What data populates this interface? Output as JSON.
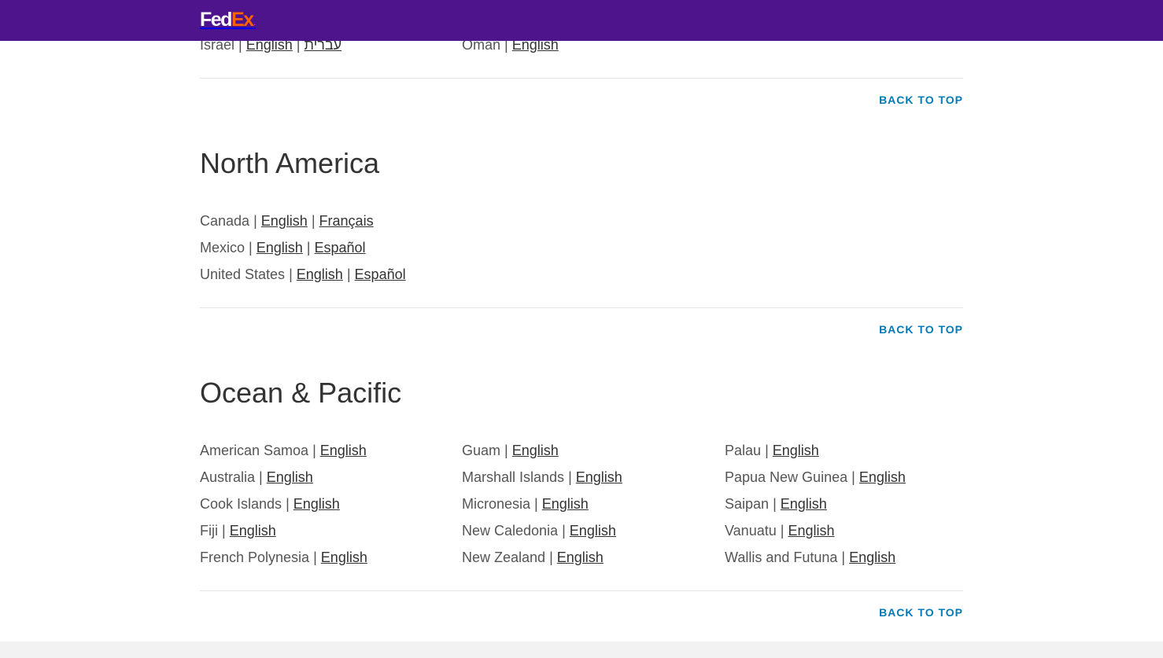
{
  "header": {
    "logo_fed": "Fed",
    "logo_ex": "Ex",
    "logo_dot": "."
  },
  "back_to_top": "BACK TO TOP",
  "separator": "|",
  "middle_east": {
    "columns": [
      [
        {
          "country": "Israel",
          "languages": [
            "English",
            "עברית"
          ]
        }
      ],
      [
        {
          "country": "Oman",
          "languages": [
            "English"
          ]
        }
      ]
    ]
  },
  "north_america": {
    "title": "North America",
    "columns": [
      [
        {
          "country": "Canada",
          "languages": [
            "English",
            "Français"
          ]
        },
        {
          "country": "Mexico",
          "languages": [
            "English",
            "Español"
          ]
        },
        {
          "country": "United States",
          "languages": [
            "English",
            "Español"
          ]
        }
      ]
    ]
  },
  "ocean_pacific": {
    "title": "Ocean & Pacific",
    "columns": [
      [
        {
          "country": "American Samoa",
          "languages": [
            "English"
          ]
        },
        {
          "country": "Australia",
          "languages": [
            "English"
          ]
        },
        {
          "country": "Cook Islands",
          "languages": [
            "English"
          ]
        },
        {
          "country": "Fiji",
          "languages": [
            "English"
          ]
        },
        {
          "country": "French Polynesia",
          "languages": [
            "English"
          ]
        }
      ],
      [
        {
          "country": "Guam",
          "languages": [
            "English"
          ]
        },
        {
          "country": "Marshall Islands",
          "languages": [
            "English"
          ]
        },
        {
          "country": "Micronesia",
          "languages": [
            "English"
          ]
        },
        {
          "country": "New Caledonia",
          "languages": [
            "English"
          ]
        },
        {
          "country": "New Zealand",
          "languages": [
            "English"
          ]
        }
      ],
      [
        {
          "country": "Palau",
          "languages": [
            "English"
          ]
        },
        {
          "country": "Papua New Guinea",
          "languages": [
            "English"
          ]
        },
        {
          "country": "Saipan",
          "languages": [
            "English"
          ]
        },
        {
          "country": "Vanuatu",
          "languages": [
            "English"
          ]
        },
        {
          "country": "Wallis and Futuna",
          "languages": [
            "English"
          ]
        }
      ]
    ]
  },
  "colors": {
    "header": "#4d148c",
    "accent": "#ff6200",
    "link_blue": "#007ab7"
  }
}
